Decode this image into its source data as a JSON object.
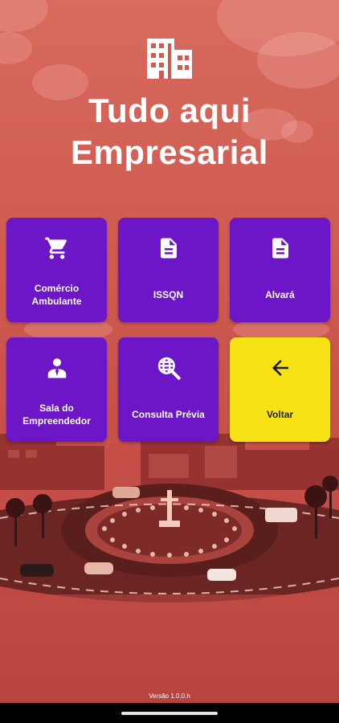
{
  "title": {
    "line1": "Tudo aqui",
    "line2": "Empresarial"
  },
  "menu": [
    {
      "label": "Comércio Ambulante",
      "icon": "shopping-cart-icon"
    },
    {
      "label": "ISSQN",
      "icon": "document-icon"
    },
    {
      "label": "Alvará",
      "icon": "document-icon"
    },
    {
      "label": "Sala do Empreendedor",
      "icon": "entrepreneur-icon"
    },
    {
      "label": "Consulta Prévia",
      "icon": "globe-search-icon"
    },
    {
      "label": "Voltar",
      "icon": "arrow-left-icon"
    }
  ],
  "footer": {
    "version": "Versão 1.0.0.h"
  },
  "colors": {
    "tile": "#6c16c8",
    "back_tile": "#f7e215",
    "background": "#cf5b51"
  }
}
